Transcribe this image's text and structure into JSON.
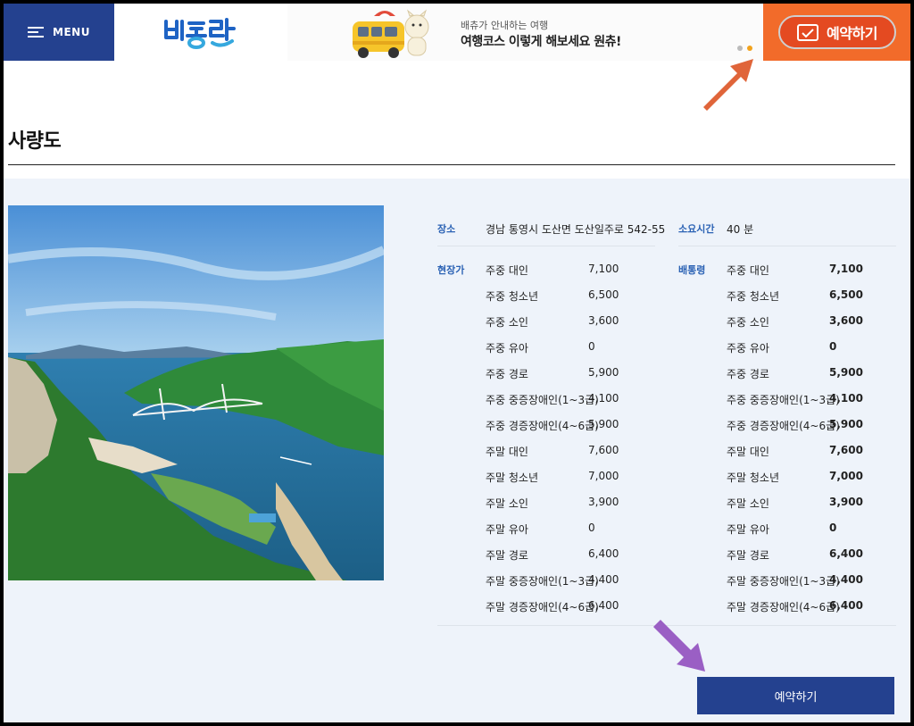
{
  "header": {
    "menu_label": "MENU",
    "banner_subtitle": "배츄가 안내하는 여행",
    "banner_title": "여행코스 이렇게 해보세요 원츄!",
    "reserve_label": "예약하기"
  },
  "colors": {
    "brand_blue": "#24418f",
    "accent_orange": "#f26b2a",
    "label_blue": "#2b62b4",
    "arrow_orange": "#e0653a",
    "arrow_purple": "#9a5fc4"
  },
  "page": {
    "title": "사량도"
  },
  "info": {
    "location_label": "장소",
    "location_value": "경남 통영시 도산면 도산일주로 542-55",
    "duration_label": "소요시간",
    "duration_value": "40 분"
  },
  "onsite": {
    "label": "현장가",
    "rows": [
      {
        "name": "주중 대인",
        "price": "7,100"
      },
      {
        "name": "주중 청소년",
        "price": "6,500"
      },
      {
        "name": "주중 소인",
        "price": "3,600"
      },
      {
        "name": "주중 유아",
        "price": "0"
      },
      {
        "name": "주중 경로",
        "price": "5,900"
      },
      {
        "name": "주중 중증장애인(1~3급)",
        "price": "4,100"
      },
      {
        "name": "주중 경증장애인(4~6급)",
        "price": "5,900"
      },
      {
        "name": "주말 대인",
        "price": "7,600"
      },
      {
        "name": "주말 청소년",
        "price": "7,000"
      },
      {
        "name": "주말 소인",
        "price": "3,900"
      },
      {
        "name": "주말 유아",
        "price": "0"
      },
      {
        "name": "주말 경로",
        "price": "6,400"
      },
      {
        "name": "주말 중증장애인(1~3급)",
        "price": "4,400"
      },
      {
        "name": "주말 경증장애인(4~6급)",
        "price": "6,400"
      }
    ]
  },
  "online": {
    "label": "배통령",
    "rows": [
      {
        "name": "주중 대인",
        "price": "7,100"
      },
      {
        "name": "주중 청소년",
        "price": "6,500"
      },
      {
        "name": "주중 소인",
        "price": "3,600"
      },
      {
        "name": "주중 유아",
        "price": "0"
      },
      {
        "name": "주중 경로",
        "price": "5,900"
      },
      {
        "name": "주중 중증장애인(1~3급)",
        "price": "4,100"
      },
      {
        "name": "주중 경증장애인(4~6급)",
        "price": "5,900"
      },
      {
        "name": "주말 대인",
        "price": "7,600"
      },
      {
        "name": "주말 청소년",
        "price": "7,000"
      },
      {
        "name": "주말 소인",
        "price": "3,900"
      },
      {
        "name": "주말 유아",
        "price": "0"
      },
      {
        "name": "주말 경로",
        "price": "6,400"
      },
      {
        "name": "주말 중증장애인(1~3급)",
        "price": "4,400"
      },
      {
        "name": "주말 경증장애인(4~6급)",
        "price": "6,400"
      }
    ]
  },
  "book_button_label": "예약하기",
  "icons": {
    "menu": "hamburger-icon",
    "reserve": "calendar-check-icon",
    "arrow_top": "arrow-up-right-icon",
    "arrow_bottom": "arrow-down-right-icon"
  }
}
